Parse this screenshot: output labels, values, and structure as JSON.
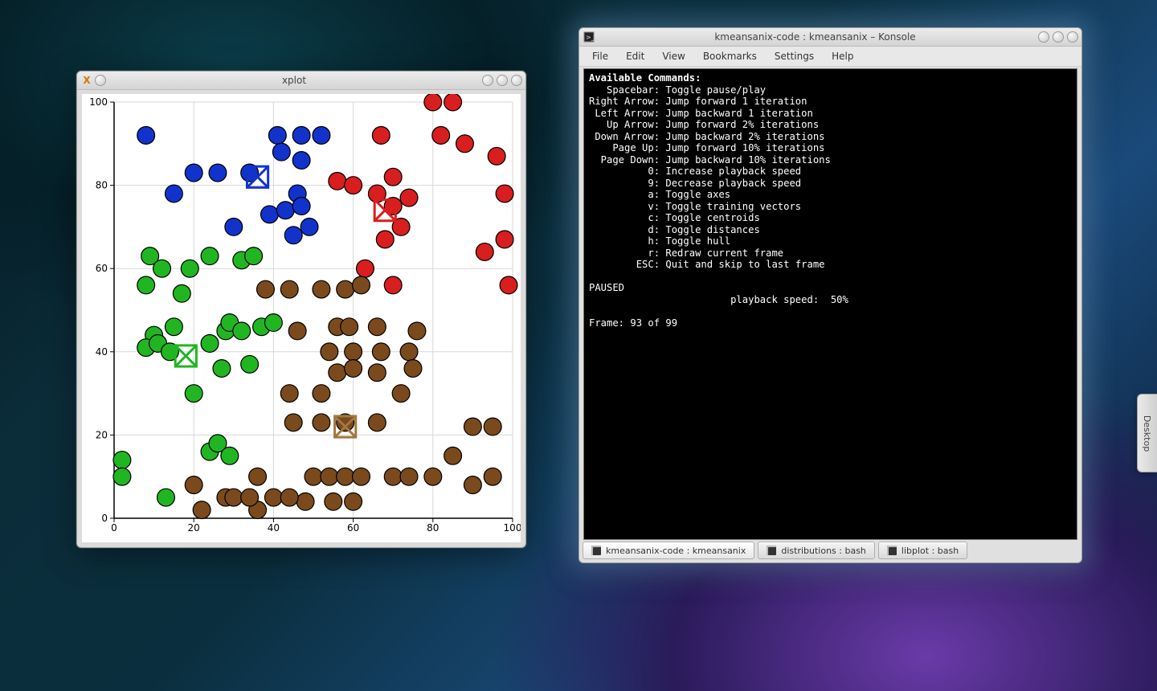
{
  "xplot": {
    "title": "xplot",
    "icon_label": "X"
  },
  "konsole": {
    "title": "kmeansanix-code : kmeansanix – Konsole",
    "menu": [
      "File",
      "Edit",
      "View",
      "Bookmarks",
      "Settings",
      "Help"
    ],
    "tabs": [
      {
        "label": "kmeansanix-code : kmeansanix",
        "active": true
      },
      {
        "label": "distributions : bash",
        "active": false
      },
      {
        "label": "libplot : bash",
        "active": false
      }
    ],
    "heading": "Available Commands:",
    "commands": [
      {
        "key": "Spacebar",
        "desc": "Toggle pause/play"
      },
      {
        "key": "Right Arrow",
        "desc": "Jump forward 1 iteration"
      },
      {
        "key": "Left Arrow",
        "desc": "Jump backward 1 iteration"
      },
      {
        "key": "Up Arrow",
        "desc": "Jump forward 2% iterations"
      },
      {
        "key": "Down Arrow",
        "desc": "Jump backward 2% iterations"
      },
      {
        "key": "Page Up",
        "desc": "Jump forward 10% iterations"
      },
      {
        "key": "Page Down",
        "desc": "Jump backward 10% iterations"
      },
      {
        "key": "0",
        "desc": "Increase playback speed"
      },
      {
        "key": "9",
        "desc": "Decrease playback speed"
      },
      {
        "key": "a",
        "desc": "Toggle axes"
      },
      {
        "key": "v",
        "desc": "Toggle training vectors"
      },
      {
        "key": "c",
        "desc": "Toggle centroids"
      },
      {
        "key": "d",
        "desc": "Toggle distances"
      },
      {
        "key": "h",
        "desc": "Toggle hull"
      },
      {
        "key": "r",
        "desc": "Redraw current frame"
      },
      {
        "key": "ESC",
        "desc": "Quit and skip to last frame"
      }
    ],
    "status_line": "PAUSED",
    "playback_label": "playback speed:",
    "playback_value": "50%",
    "frame_line": "Frame: 93 of 99"
  },
  "edge_tab": {
    "label": "Desktop"
  },
  "chart_data": {
    "type": "scatter",
    "title": "",
    "xlabel": "",
    "ylabel": "",
    "xlim": [
      0,
      100
    ],
    "ylim": [
      0,
      100
    ],
    "xticks": [
      0,
      20,
      40,
      60,
      80,
      100
    ],
    "yticks": [
      0,
      20,
      40,
      60,
      80,
      100
    ],
    "grid": true,
    "point_radius_data": 2.2,
    "colors": {
      "blue": "#1133cc",
      "red": "#d81e1e",
      "green": "#22b522",
      "brown": "#7a4a1c"
    },
    "centroids": [
      {
        "cluster": "blue",
        "x": 36,
        "y": 82,
        "color": "#1133cc"
      },
      {
        "cluster": "red",
        "x": 68,
        "y": 74,
        "color": "#d81e1e"
      },
      {
        "cluster": "green",
        "x": 18,
        "y": 39,
        "color": "#22b522"
      },
      {
        "cluster": "brown",
        "x": 58,
        "y": 22,
        "color": "#a07840"
      }
    ],
    "series": [
      {
        "name": "blue",
        "color": "#1133cc",
        "points": [
          [
            8,
            92
          ],
          [
            15,
            78
          ],
          [
            20,
            83
          ],
          [
            26,
            83
          ],
          [
            34,
            83
          ],
          [
            30,
            70
          ],
          [
            41,
            92
          ],
          [
            42,
            88
          ],
          [
            47,
            92
          ],
          [
            47,
            86
          ],
          [
            46,
            78
          ],
          [
            52,
            92
          ],
          [
            39,
            73
          ],
          [
            43,
            74
          ],
          [
            47,
            75
          ],
          [
            45,
            68
          ],
          [
            49,
            70
          ]
        ]
      },
      {
        "name": "red",
        "color": "#d81e1e",
        "points": [
          [
            56,
            81
          ],
          [
            60,
            80
          ],
          [
            66,
            78
          ],
          [
            70,
            82
          ],
          [
            70,
            75
          ],
          [
            74,
            77
          ],
          [
            72,
            70
          ],
          [
            68,
            67
          ],
          [
            63,
            60
          ],
          [
            70,
            56
          ],
          [
            67,
            92
          ],
          [
            80,
            100
          ],
          [
            85,
            100
          ],
          [
            82,
            92
          ],
          [
            88,
            90
          ],
          [
            96,
            87
          ],
          [
            93,
            64
          ],
          [
            98,
            67
          ],
          [
            99,
            56
          ],
          [
            98,
            78
          ]
        ]
      },
      {
        "name": "green",
        "color": "#22b522",
        "points": [
          [
            9,
            63
          ],
          [
            8,
            56
          ],
          [
            12,
            60
          ],
          [
            19,
            60
          ],
          [
            17,
            54
          ],
          [
            24,
            63
          ],
          [
            32,
            62
          ],
          [
            35,
            63
          ],
          [
            10,
            44
          ],
          [
            8,
            41
          ],
          [
            11,
            42
          ],
          [
            15,
            46
          ],
          [
            14,
            40
          ],
          [
            24,
            42
          ],
          [
            28,
            45
          ],
          [
            29,
            47
          ],
          [
            32,
            45
          ],
          [
            37,
            46
          ],
          [
            27,
            36
          ],
          [
            34,
            37
          ],
          [
            40,
            47
          ],
          [
            20,
            30
          ],
          [
            24,
            16
          ],
          [
            26,
            18
          ],
          [
            29,
            15
          ],
          [
            2,
            14
          ],
          [
            2,
            10
          ],
          [
            13,
            5
          ]
        ]
      },
      {
        "name": "brown",
        "color": "#7a4a1c",
        "points": [
          [
            38,
            55
          ],
          [
            44,
            55
          ],
          [
            52,
            55
          ],
          [
            58,
            55
          ],
          [
            62,
            56
          ],
          [
            46,
            45
          ],
          [
            56,
            46
          ],
          [
            59,
            46
          ],
          [
            66,
            46
          ],
          [
            76,
            45
          ],
          [
            54,
            40
          ],
          [
            60,
            40
          ],
          [
            67,
            40
          ],
          [
            74,
            40
          ],
          [
            56,
            35
          ],
          [
            60,
            36
          ],
          [
            66,
            35
          ],
          [
            75,
            36
          ],
          [
            44,
            30
          ],
          [
            52,
            30
          ],
          [
            72,
            30
          ],
          [
            45,
            23
          ],
          [
            52,
            23
          ],
          [
            58,
            23
          ],
          [
            66,
            23
          ],
          [
            36,
            10
          ],
          [
            36,
            2
          ],
          [
            48,
            4
          ],
          [
            55,
            4
          ],
          [
            60,
            4
          ],
          [
            90,
            22
          ],
          [
            95,
            22
          ],
          [
            20,
            8
          ],
          [
            22,
            2
          ],
          [
            28,
            5
          ],
          [
            30,
            5
          ],
          [
            34,
            5
          ],
          [
            40,
            5
          ],
          [
            44,
            5
          ],
          [
            50,
            10
          ],
          [
            54,
            10
          ],
          [
            58,
            10
          ],
          [
            62,
            10
          ],
          [
            70,
            10
          ],
          [
            74,
            10
          ],
          [
            80,
            10
          ],
          [
            85,
            15
          ],
          [
            90,
            8
          ],
          [
            95,
            10
          ]
        ]
      }
    ]
  }
}
